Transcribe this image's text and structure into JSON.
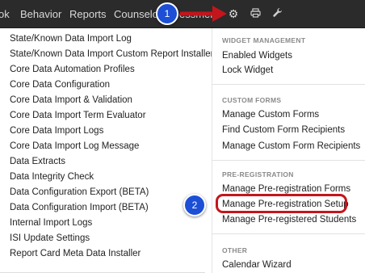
{
  "nav": {
    "items": [
      "ok",
      "Behavior",
      "Reports",
      "Counselor",
      "essment"
    ],
    "icons": [
      "gear-icon",
      "printer-icon",
      "wrench-icon"
    ]
  },
  "left_menu": [
    "State/Known Data Import Log",
    "State/Known Data Import Custom Report Installer",
    "Core Data Automation Profiles",
    "Core Data Configuration",
    "Core Data Import & Validation",
    "Core Data Import Term Evaluator",
    "Core Data Import Logs",
    "Core Data Import Log Message",
    "Data Extracts",
    "Data Integrity Check",
    "Data Configuration Export (BETA)",
    "Data Configuration Import (BETA)",
    "Internal Import Logs",
    "ISI Update Settings",
    "Report Card Meta Data Installer"
  ],
  "right_menu": {
    "widget": {
      "heading": "WIDGET MANAGEMENT",
      "items": [
        "Enabled Widgets",
        "Lock Widget"
      ]
    },
    "custom_forms": {
      "heading": "CUSTOM FORMS",
      "items": [
        "Manage Custom Forms",
        "Find Custom Form Recipients",
        "Manage Custom Form Recipients"
      ]
    },
    "pre_registration": {
      "heading": "PRE-REGISTRATION",
      "items": [
        "Manage Pre-registration Forms",
        "Manage Pre-registration Setup",
        "Manage Pre-registered Students"
      ]
    },
    "other": {
      "heading": "OTHER",
      "items": [
        "Calendar Wizard"
      ]
    }
  },
  "callouts": [
    "1",
    "2"
  ],
  "colors": {
    "topbar": "#2b2b2b",
    "callout": "#1c4fd6",
    "highlight": "#c4151c"
  }
}
